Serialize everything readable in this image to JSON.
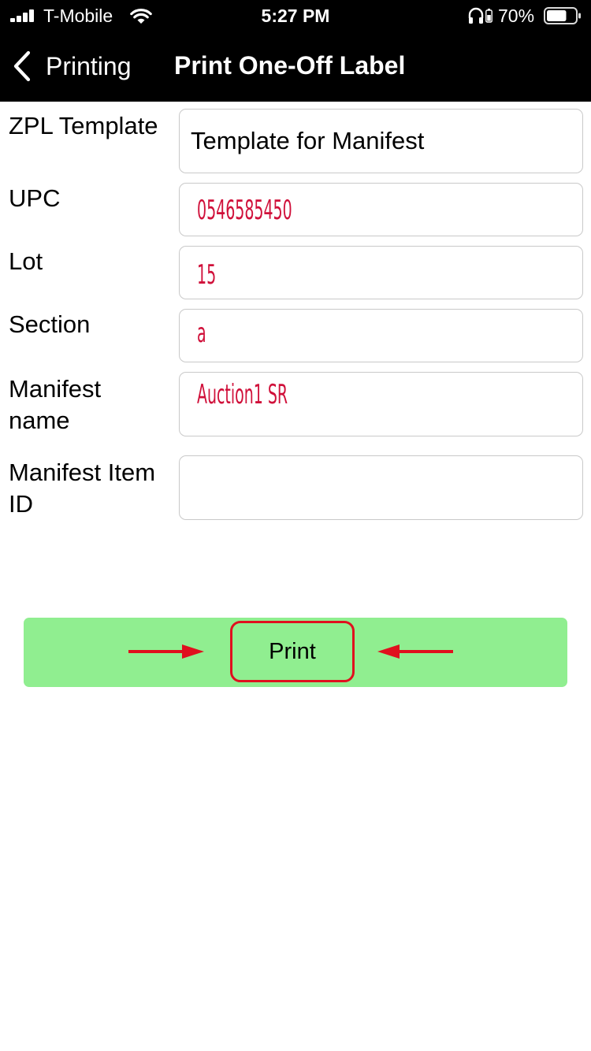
{
  "status_bar": {
    "carrier": "T-Mobile",
    "time": "5:27 PM",
    "battery_percent": "70%",
    "battery_level": 0.7,
    "icons": [
      "signal-icon",
      "wifi-icon",
      "headphones-icon",
      "charging-icon",
      "battery-icon"
    ]
  },
  "nav": {
    "back_label": "Printing",
    "title": "Print One-Off Label",
    "back_icon": "chevron-left-icon"
  },
  "form": {
    "zpl_template": {
      "label": "ZPL Template",
      "value": "Template for Manifest"
    },
    "upc": {
      "label": "UPC",
      "value": "0546585450"
    },
    "lot": {
      "label": "Lot",
      "value": "15"
    },
    "section": {
      "label": "Section",
      "value": "a"
    },
    "manifest_name": {
      "label": "Manifest name",
      "value": "Auction1 SR"
    },
    "manifest_item_id": {
      "label": "Manifest Item ID",
      "value": ""
    }
  },
  "print": {
    "button_label": "Print",
    "bar_color": "#90ee90",
    "highlight_color": "#e0101e",
    "annotation_icons": [
      "arrow-right-icon",
      "arrow-left-icon"
    ]
  },
  "colors": {
    "handwriting": "#d0103a",
    "header_bg": "#000000"
  }
}
